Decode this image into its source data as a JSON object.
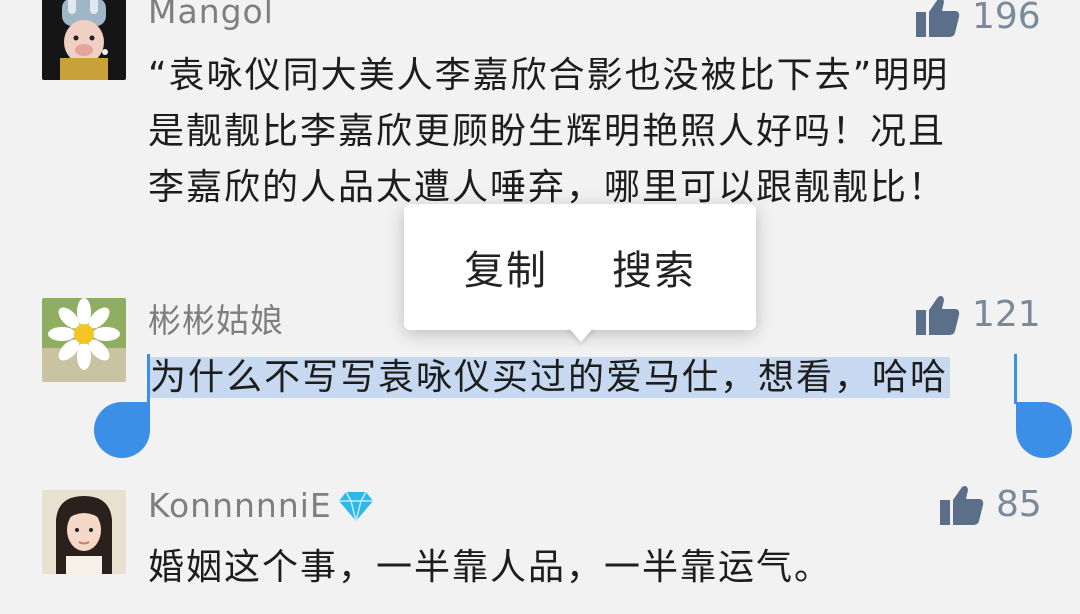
{
  "comments": [
    {
      "username": "Mangol",
      "likes": "196",
      "text_lines": [
        "“袁咏仪同大美人李嘉欣合影也没被比下去”明明",
        "是靓靓比李嘉欣更顾盼生辉明艳照人好吗！况且",
        "李嘉欣的人品太遭人唾弃，哪里可以跟靓靓比！"
      ],
      "avatar_icon": "girl-with-pearl-earring-parody-avatar"
    },
    {
      "username": "彬彬姑娘",
      "likes": "121",
      "text_lines": [
        "为什么不写写袁咏仪买过的爱马仕，想看，哈哈"
      ],
      "avatar_icon": "daisy-flower-avatar"
    },
    {
      "username": "KonnnnniE",
      "likes": "85",
      "text_lines": [
        "婚姻这个事，一半靠人品，一半靠运气。"
      ],
      "avatar_icon": "girl-portrait-avatar",
      "badge_icon": "diamond-icon"
    }
  ],
  "context_menu": {
    "copy_label": "复制",
    "search_label": "搜索"
  },
  "colors": {
    "background": "#f2f2f2",
    "selection": "#c6d9f0",
    "handle": "#3b8fe6",
    "like_icon": "#5b6f8a",
    "username": "#7f7f7f"
  },
  "watermark": " "
}
